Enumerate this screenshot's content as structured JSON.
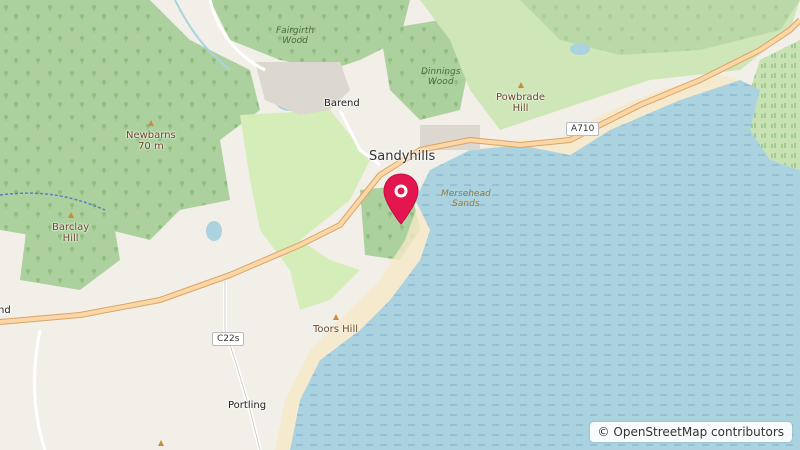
{
  "map": {
    "labels": {
      "sandyhills": "Sandyhills",
      "barend": "Barend",
      "portling": "Portling",
      "fairgirth_wood": "Fairgirth\nWood",
      "dinnings_wood": "Dinnings\nWood",
      "mersehead_sands": "Mersehead\nSands",
      "newbarns": "Newbarns\n70 m",
      "barclay_hill": "Barclay\nHill",
      "powbrade_hill": "Powbrade\nHill",
      "toors_hill": "Toors Hill",
      "edge_fragment": "nd"
    },
    "roads": {
      "a710": "A710",
      "c22s": "C22s"
    },
    "attribution": {
      "symbol": "©",
      "text": "OpenStreetMap contributors"
    },
    "colors": {
      "land": "#f2efe9",
      "forest": "#add19e",
      "park": "#d5edb8",
      "water": "#aad3df",
      "sea_stripe": "#8cb7d4",
      "sand": "#f5e9c6",
      "road": "#fcd6a4",
      "road_casing": "#d6a66a",
      "marker": "#e3164f",
      "built": "#dcd7cf"
    },
    "marker_icon": "map-pin-icon"
  }
}
